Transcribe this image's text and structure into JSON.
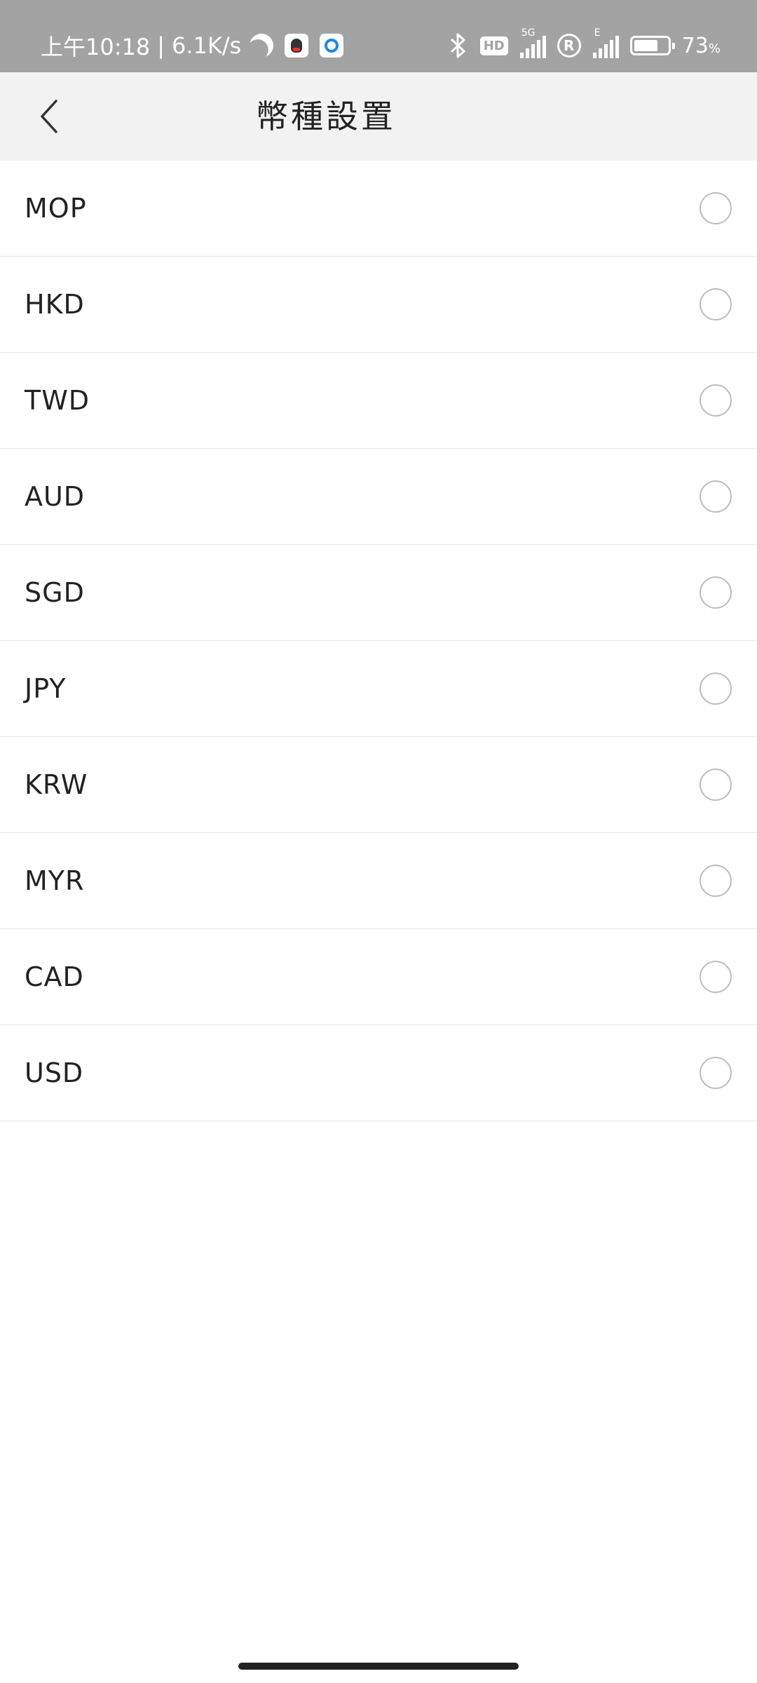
{
  "status_bar": {
    "time": "上午10:18",
    "speed": "6.1K/s",
    "separator": "|",
    "hd_label": "HD",
    "network_5g": "5G",
    "network_e": "E",
    "roaming": "R",
    "battery_value": "73",
    "battery_unit": "%",
    "battery_level": 0.73,
    "icons": [
      "moon-icon",
      "qq-icon",
      "app-icon",
      "bluetooth-icon",
      "hd-icon",
      "signal-icon",
      "roaming-icon",
      "battery-icon"
    ]
  },
  "header": {
    "title": "幣種設置",
    "back_icon": "chevron-left-icon"
  },
  "currencies": [
    {
      "code": "MOP",
      "selected": false
    },
    {
      "code": "HKD",
      "selected": false
    },
    {
      "code": "TWD",
      "selected": false
    },
    {
      "code": "AUD",
      "selected": false
    },
    {
      "code": "SGD",
      "selected": false
    },
    {
      "code": "JPY",
      "selected": false
    },
    {
      "code": "KRW",
      "selected": false
    },
    {
      "code": "MYR",
      "selected": false
    },
    {
      "code": "CAD",
      "selected": false
    },
    {
      "code": "USD",
      "selected": false
    }
  ],
  "colors": {
    "status_bar_bg": "#a3a3a3",
    "header_bg": "#f2f2f2",
    "radio_border": "#bdbdbd",
    "divider": "#e6e6e6"
  }
}
